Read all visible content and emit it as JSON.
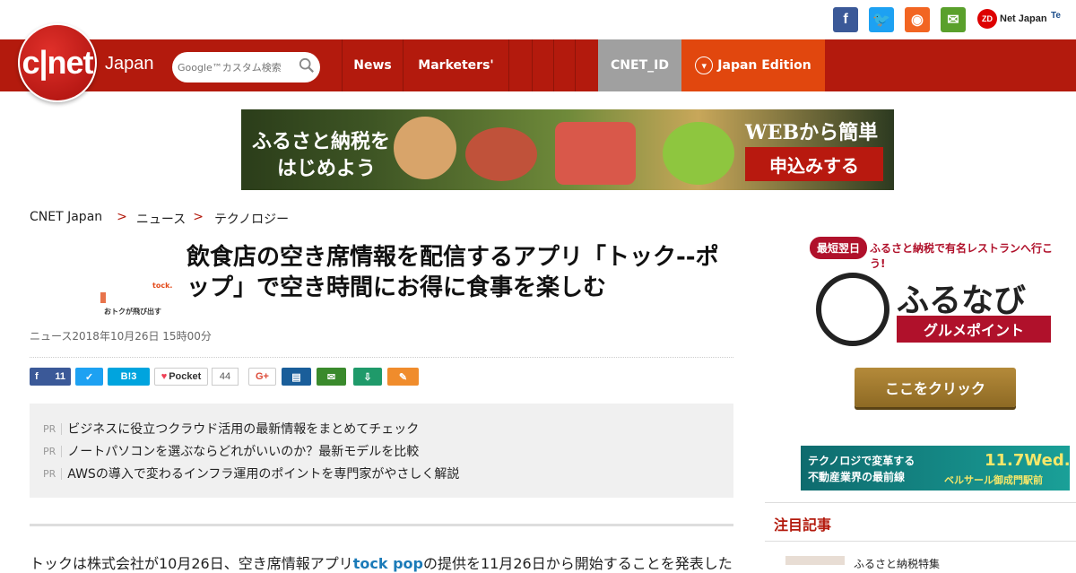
{
  "topbar": {
    "social": [
      {
        "name": "facebook-icon",
        "glyph": "f",
        "color": "#3b5998"
      },
      {
        "name": "twitter-icon",
        "glyph": "🐦",
        "color": "#1da1f2"
      },
      {
        "name": "rss-icon",
        "glyph": "◉",
        "color": "#f26522"
      },
      {
        "name": "mail-icon",
        "glyph": "✉",
        "color": "#5aa02c"
      }
    ],
    "zdnet": "Net Japan",
    "zdnet_logo": "ZD",
    "techrepublic": "Te"
  },
  "nav": {
    "logo": "c|net",
    "logo_suffix": "Japan",
    "search_placeholder": "Google™カスタム検索",
    "items": [
      "News",
      "Marketers'"
    ],
    "cnet_id": "CNET_ID",
    "edition": "Japan Edition",
    "accent": "#b31a0d"
  },
  "banner": {
    "line1": "ふるさと納税を",
    "line2": "はじめよう",
    "right1": "WEBから簡単",
    "right2": "申込みする"
  },
  "breadcrumb": [
    "CNET Japan",
    "ニュース",
    "テクノロジー"
  ],
  "article": {
    "headline": "飲食店の空き席情報を配信するアプリ「トック--ポップ」で空き時間にお得に食事を楽しむ",
    "meta": "ニュース2018年10月26日 15時00分",
    "thumb_brand": "tock.",
    "thumb_text": "おトクが飛び出す"
  },
  "share": {
    "facebook_count": "11",
    "hatena": "B!3",
    "pocket": "Pocket",
    "pocket_count": "44",
    "google": "G+"
  },
  "pr": {
    "label": "PR",
    "items": [
      "ビジネスに役立つクラウド活用の最新情報をまとめてチェック",
      "ノートパソコンを選ぶならどれがいいのか？最新モデルを比較",
      "AWSの導入で変わるインフラ運用のポイントを専門家がやさしく解説"
    ]
  },
  "body": {
    "before": "トックは株式会社が10月26日、空き席情報アプリ",
    "link": "tock pop",
    "after": "の提供を11月26日から開始することを発表した"
  },
  "sidebar": {
    "furu_badge": "最短翌日",
    "furu_tag": "ふるさと納税で有名レストランへ行こう!",
    "furu_brand": "ふるなび",
    "furu_sub": "グルメポイント",
    "furu_click": "ここをクリック",
    "tech_a": "テクノロジで変革する",
    "tech_b": "不動産業界の最前線",
    "tech_date": "11.7Wed.",
    "tech_place": "ベルサール御成門駅前",
    "section_title": "注目記事",
    "teaser": "ふるさと納税特集"
  }
}
